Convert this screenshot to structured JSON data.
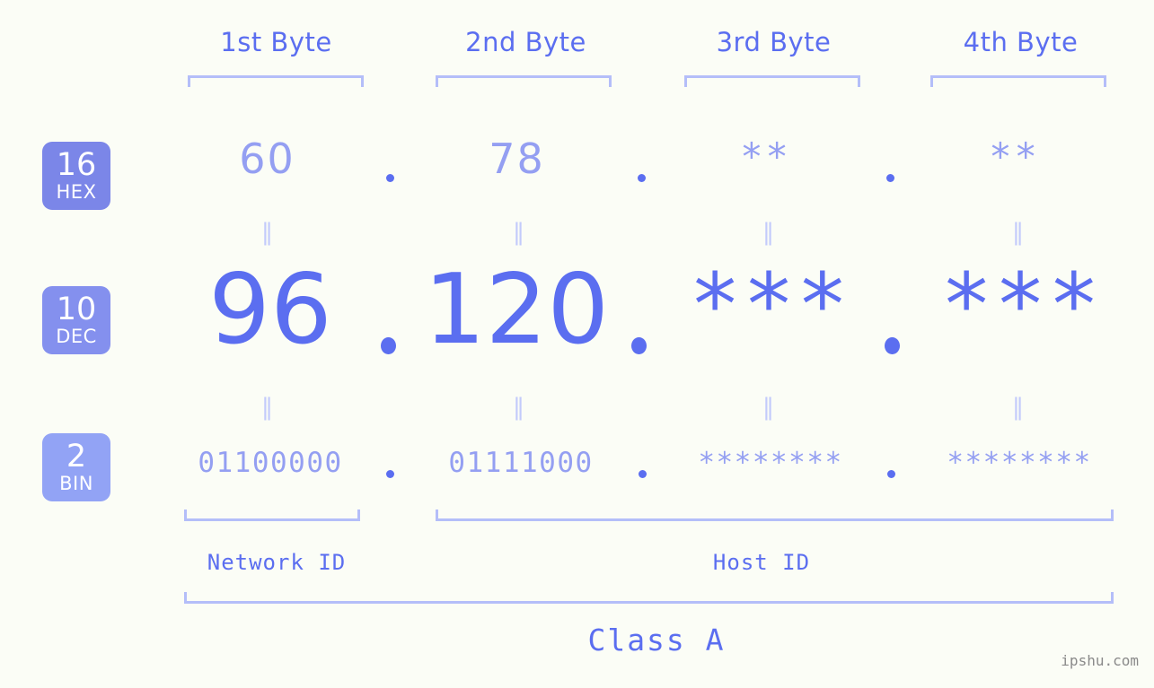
{
  "background_color": "#fbfdf6",
  "accent_color": "#5b6ef0",
  "muted_accent_color": "#949ff2",
  "bracket_color": "#b4bef9",
  "byte_headers": [
    {
      "label": "1st Byte"
    },
    {
      "label": "2nd Byte"
    },
    {
      "label": "3rd Byte"
    },
    {
      "label": "4th Byte"
    }
  ],
  "rows": [
    {
      "base": "16",
      "system": "HEX",
      "badge_color": "#7b86e8",
      "values": [
        "60",
        "78",
        "**",
        "**"
      ],
      "separators": [
        ".",
        ".",
        "."
      ]
    },
    {
      "base": "10",
      "system": "DEC",
      "badge_color": "#8490ee",
      "values": [
        "96",
        "120",
        "***",
        "***"
      ],
      "separators": [
        ".",
        ".",
        "."
      ]
    },
    {
      "base": "2",
      "system": "BIN",
      "badge_color": "#92a3f5",
      "values": [
        "01100000",
        "01111000",
        "********",
        "********"
      ],
      "separators": [
        ".",
        ".",
        "."
      ]
    }
  ],
  "equality_marks": {
    "glyph": "‖",
    "hex_to_dec_count": 4,
    "dec_to_bin_count": 4
  },
  "segments": {
    "network_id": "Network ID",
    "host_id": "Host ID"
  },
  "class_label": "Class A",
  "watermark": "ipshu.com"
}
